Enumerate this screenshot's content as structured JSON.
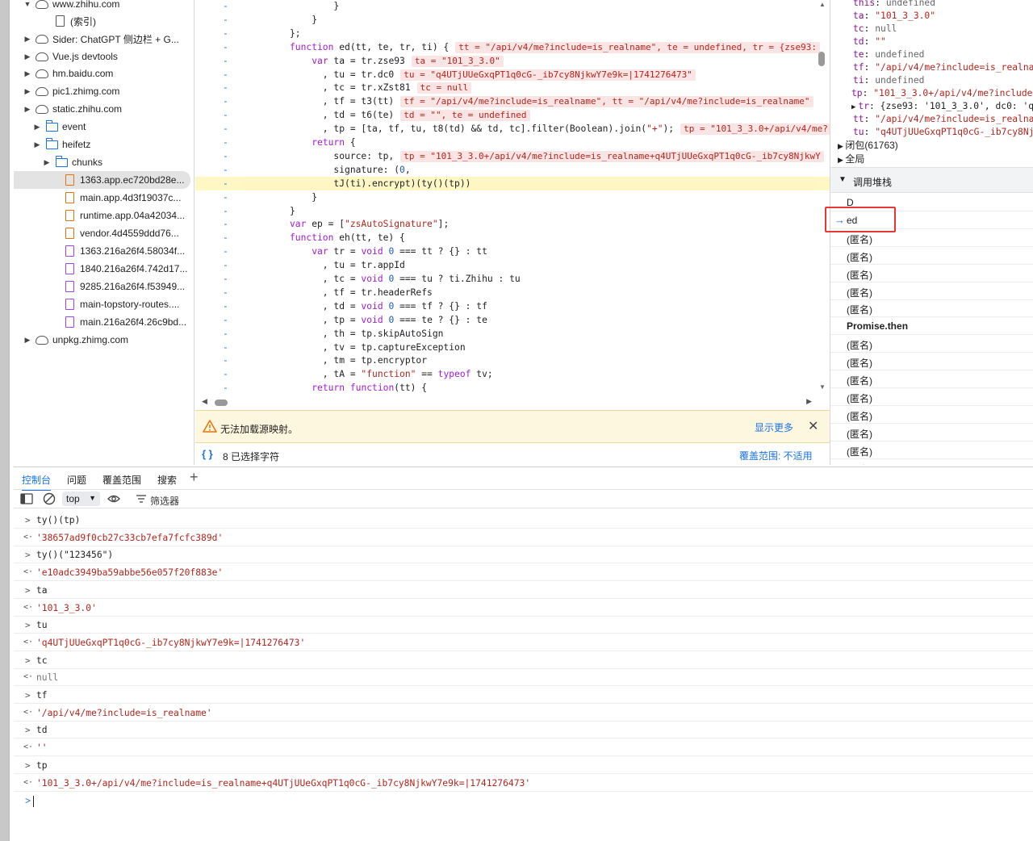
{
  "file_tree": [
    {
      "label": "www.zhihu.com",
      "type": "cloud",
      "expanded": true
    },
    {
      "label": "(索引)",
      "type": "doc"
    },
    {
      "label": "Sider: ChatGPT 侧边栏 + G...",
      "type": "cloud"
    },
    {
      "label": "Vue.js devtools",
      "type": "cloud"
    },
    {
      "label": "hm.baidu.com",
      "type": "cloud"
    },
    {
      "label": "pic1.zhimg.com",
      "type": "cloud"
    },
    {
      "label": "static.zhihu.com",
      "type": "cloud",
      "expanded": true
    },
    {
      "label": "event",
      "type": "folder"
    },
    {
      "label": "heifetz",
      "type": "folder",
      "expanded": true
    },
    {
      "label": "chunks",
      "type": "folder"
    },
    {
      "label": "1363.app.ec720bd28e...",
      "type": "file",
      "selected": true
    },
    {
      "label": "main.app.4d3f19037c...",
      "type": "file"
    },
    {
      "label": "runtime.app.04a42034...",
      "type": "file"
    },
    {
      "label": "vendor.4d4559ddd76...",
      "type": "file"
    },
    {
      "label": "1363.216a26f4.58034f...",
      "type": "file-purple"
    },
    {
      "label": "1840.216a26f4.742d17...",
      "type": "file-purple"
    },
    {
      "label": "9285.216a26f4.f53949...",
      "type": "file-purple"
    },
    {
      "label": "main-topstory-routes....",
      "type": "file-purple"
    },
    {
      "label": "main.216a26f4.26c9bd...",
      "type": "file-purple"
    },
    {
      "label": "unpkg.zhimg.com",
      "type": "cloud"
    }
  ],
  "code_lines": [
    {
      "text": "        }",
      "inline": ""
    },
    {
      "text": "    }",
      "inline": ""
    },
    {
      "text": "};",
      "inline": ""
    },
    {
      "text": "function ed(tt, te, tr, ti) {",
      "inline": "tt = \"/api/v4/me?include=is_realname\", te = undefined, tr = {zse93:"
    },
    {
      "text": "    var ta = tr.zse93",
      "inline": "ta = \"101_3_3.0\""
    },
    {
      "text": "      , tu = tr.dc0",
      "inline": "tu = \"q4UTjUUeGxqPT1q0cG-_ib7cy8NjkwY7e9k=|1741276473\""
    },
    {
      "text": "      , tc = tr.xZst81",
      "inline": "tc = null"
    },
    {
      "text": "      , tf = t3(tt)",
      "inline": "tf = \"/api/v4/me?include=is_realname\", tt = \"/api/v4/me?include=is_realname\""
    },
    {
      "text": "      , td = t6(te)",
      "inline": "td = \"\", te = undefined"
    },
    {
      "text": "      , tp = [ta, tf, tu, t8(td) && td, tc].filter(Boolean).join(\"+\");",
      "inline": "tp = \"101_3_3.0+/api/v4/me?"
    },
    {
      "text": "    return {",
      "inline": ""
    },
    {
      "text": "        source: tp,",
      "inline": "tp = \"101_3_3.0+/api/v4/me?include=is_realname+q4UTjUUeGxqPT1q0cG-_ib7cy8NjkwY"
    },
    {
      "text": "        signature: (0,",
      "inline": ""
    },
    {
      "text": "        tJ(ti).encrypt)(ty()(tp))",
      "inline": "",
      "highlight": true
    },
    {
      "text": "    }",
      "inline": ""
    },
    {
      "text": "}",
      "inline": ""
    },
    {
      "text": "var ep = [\"zsAutoSignature\"];",
      "inline": ""
    },
    {
      "text": "function eh(tt, te) {",
      "inline": ""
    },
    {
      "text": "    var tr = void 0 === tt ? {} : tt",
      "inline": ""
    },
    {
      "text": "      , tu = tr.appId",
      "inline": ""
    },
    {
      "text": "      , tc = void 0 === tu ? ti.Zhihu : tu",
      "inline": ""
    },
    {
      "text": "      , tf = tr.headerRefs",
      "inline": ""
    },
    {
      "text": "      , td = void 0 === tf ? {} : tf",
      "inline": ""
    },
    {
      "text": "      , tp = void 0 === te ? {} : te",
      "inline": ""
    },
    {
      "text": "      , th = tp.skipAutoSign",
      "inline": ""
    },
    {
      "text": "      , tv = tp.captureException",
      "inline": ""
    },
    {
      "text": "      , tm = tp.encryptor",
      "inline": ""
    },
    {
      "text": "      , tA = \"function\" == typeof tv;",
      "inline": ""
    },
    {
      "text": "    return function(tt) {",
      "inline": ""
    }
  ],
  "warning": {
    "message": "无法加载源映射。",
    "show_more": "显示更多"
  },
  "status_bar": {
    "braces": "{ }",
    "selection": "8 已选择字符",
    "coverage": "覆盖范围: 不适用"
  },
  "scope": [
    {
      "key": "this",
      "value": "undefined",
      "kind": "null",
      "indent": 30
    },
    {
      "key": "ta",
      "value": "\"101_3_3.0\"",
      "kind": "str",
      "indent": 30
    },
    {
      "key": "tc",
      "value": "null",
      "kind": "null",
      "indent": 30
    },
    {
      "key": "td",
      "value": "\"\"",
      "kind": "str",
      "indent": 30
    },
    {
      "key": "te",
      "value": "undefined",
      "kind": "null",
      "indent": 30
    },
    {
      "key": "tf",
      "value": "\"/api/v4/me?include=is_realnam",
      "kind": "str",
      "indent": 30
    },
    {
      "key": "ti",
      "value": "undefined",
      "kind": "null",
      "indent": 30
    },
    {
      "key": "tp",
      "value": "\"101_3_3.0+/api/v4/me?include=",
      "kind": "str",
      "indent": 28
    },
    {
      "key": "tr",
      "value": "{zse93: '101_3_3.0', dc0: 'q4U",
      "kind": "obj",
      "indent": 28,
      "expandable": true
    },
    {
      "key": "tt",
      "value": "\"/api/v4/me?include=is_realnam",
      "kind": "str",
      "indent": 30
    },
    {
      "key": "tu",
      "value": "\"q4UTjUUeGxqPT1q0cG-_ib7cy8Njk",
      "kind": "str",
      "indent": 30
    }
  ],
  "scope_sections": [
    "闭包(61763)",
    "全局"
  ],
  "call_stack": {
    "header": "调用堆栈",
    "frames": [
      "D",
      "ed",
      "(匿名)",
      "(匿名)",
      "(匿名)",
      "(匿名)",
      "(匿名)",
      "Promise.then",
      "(匿名)",
      "(匿名)",
      "(匿名)",
      "(匿名)",
      "(匿名)",
      "(匿名)",
      "(匿名)",
      "(匿名)"
    ]
  },
  "console_tabs": [
    "控制台",
    "问题",
    "覆盖范围",
    "搜索"
  ],
  "console_toolbar": {
    "context": "top",
    "filter": "筛选器"
  },
  "console_lines": [
    {
      "type": "in",
      "text": "ty()(tp)"
    },
    {
      "type": "out",
      "text": "'38657ad9f0cb27c33cb7efa7fcfc389d'",
      "kind": "str"
    },
    {
      "type": "in",
      "text": "ty()(\"123456\")"
    },
    {
      "type": "out",
      "text": "'e10adc3949ba59abbe56e057f20f883e'",
      "kind": "str"
    },
    {
      "type": "in",
      "text": "ta"
    },
    {
      "type": "out",
      "text": "'101_3_3.0'",
      "kind": "str"
    },
    {
      "type": "in",
      "text": "tu"
    },
    {
      "type": "out",
      "text": "'q4UTjUUeGxqPT1q0cG-_ib7cy8NjkwY7e9k=|1741276473'",
      "kind": "str"
    },
    {
      "type": "in",
      "text": "tc"
    },
    {
      "type": "out",
      "text": "null",
      "kind": "nul"
    },
    {
      "type": "in",
      "text": "tf"
    },
    {
      "type": "out",
      "text": "'/api/v4/me?include=is_realname'",
      "kind": "str"
    },
    {
      "type": "in",
      "text": "td"
    },
    {
      "type": "out",
      "text": "''",
      "kind": "str"
    },
    {
      "type": "in",
      "text": "tp"
    },
    {
      "type": "out",
      "text": "'101_3_3.0+/api/v4/me?include=is_realname+q4UTjUUeGxqPT1q0cG-_ib7cy8NjkwY7e9k=|1741276473'",
      "kind": "str"
    }
  ]
}
